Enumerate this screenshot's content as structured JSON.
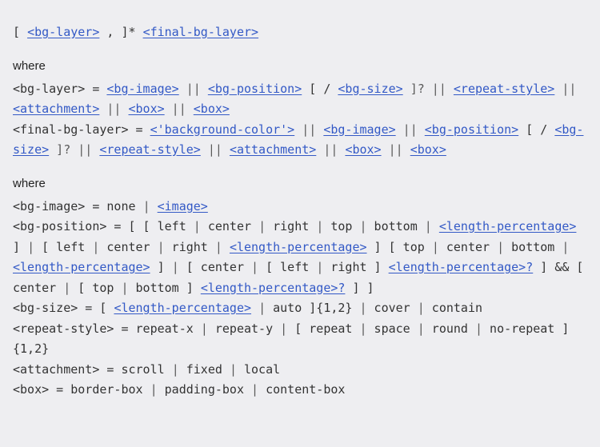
{
  "where": "where",
  "top": {
    "t1": "[ ",
    "bg_layer": "<bg-layer>",
    "t2": " , ]* ",
    "final_bg_layer": "<final-bg-layer>"
  },
  "block1": {
    "l0": {
      "a": "<bg-layer>",
      "b": " = ",
      "bg_image": "<bg-image>",
      "c": " || ",
      "bg_position": "<bg-position>",
      "d": " [ / ",
      "bg_size": "<bg-size>",
      "e": " ]? || ",
      "repeat_style": "<repeat-style>",
      "f": " || ",
      "attachment": "<attachment>",
      "g": " || ",
      "box1": "<box>",
      "h": " || ",
      "box2": "<box>"
    },
    "l1": {
      "a": "<final-bg-layer>",
      "b": " = ",
      "bgcolor": "<'background-color'>",
      "c": " || ",
      "bg_image": "<bg-image>",
      "d": " || ",
      "bg_position": "<bg-position>",
      "e": " [ / ",
      "bg_size": "<bg-size>",
      "f": " ]? || ",
      "repeat_style": "<repeat-style>",
      "g": " || ",
      "attachment": "<attachment>",
      "h": " || ",
      "box1": "<box>",
      "i": " || ",
      "box2": "<box>"
    }
  },
  "block2": {
    "l0": {
      "a": "<bg-image>",
      "b": " = none ",
      "c": "|",
      "d": " ",
      "image": "<image>"
    },
    "l1": {
      "a": "<bg-position>",
      "b": " = [ [ left ",
      "c": "|",
      "d": " center ",
      "e": "|",
      "f": " right ",
      "g": "|",
      "h": " top ",
      "i": "|",
      "j": " bottom ",
      "k": "|",
      "l": " ",
      "lp1": "<length-percentage>",
      "m": " ] ",
      "n": "|",
      "o": " [ left ",
      "p": "|",
      "q": " center ",
      "r": "|",
      "s": " right ",
      "t": "|",
      "u": " ",
      "lp2": "<length-percentage>",
      "v": " ] [ top ",
      "w": "|",
      "x": " center ",
      "y": "|",
      "z": " bottom ",
      "aa": "|",
      "ab": " ",
      "lp3": "<length-percentage>",
      "ac": " ] ",
      "ad": "|",
      "ae": " [ center ",
      "af": "|",
      "ag": " [ left ",
      "ah": "|",
      "ai": " right ] ",
      "lp4": "<length-percentage>?",
      "aj": " ] && [ center ",
      "ak": "|",
      "al": " [ top ",
      "am": "|",
      "an": " bottom ] ",
      "lp5": "<length-percentage>?",
      "ao": " ] ]"
    },
    "l2": {
      "a": "<bg-size>",
      "b": " = [ ",
      "lp": "<length-percentage>",
      "c": " ",
      "d": "|",
      "e": " auto ]{1,2} ",
      "f": "|",
      "g": " cover ",
      "h": "|",
      "i": " contain"
    },
    "l3": {
      "a": "<repeat-style>",
      "b": " = repeat-x ",
      "c": "|",
      "d": " repeat-y ",
      "e": "|",
      "f": " [ repeat ",
      "g": "|",
      "h": " space ",
      "i": "|",
      "j": " round ",
      "k": "|",
      "l": " no-repeat ]{1,2}"
    },
    "l4": {
      "a": "<attachment>",
      "b": " = scroll ",
      "c": "|",
      "d": " fixed ",
      "e": "|",
      "f": " local"
    },
    "l5": {
      "a": "<box>",
      "b": " = border-box ",
      "c": "|",
      "d": " padding-box ",
      "e": "|",
      "f": " content-box"
    }
  }
}
